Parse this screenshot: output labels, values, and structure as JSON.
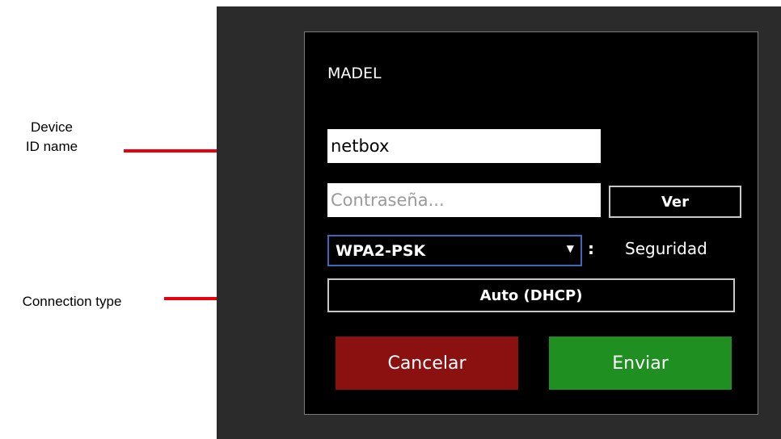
{
  "annotations": {
    "device_id": "Device\nID name",
    "connection_type": "Connection type"
  },
  "panel": {
    "title": "MADEL",
    "device_name_value": "netbox",
    "password_placeholder": "Contraseña...",
    "show_button": "Ver",
    "security_select_value": "WPA2-PSK",
    "security_colon": ":",
    "security_label": "Seguridad",
    "connection_button": "Auto (DHCP)",
    "cancel_button": "Cancelar",
    "submit_button": "Enviar"
  },
  "colors": {
    "arrow": "#e8000d",
    "cancel": "#8b1111",
    "submit": "#1f8f22",
    "select_border": "#3d6ab8"
  },
  "icons": {
    "select_caret": "caret-down-icon"
  }
}
